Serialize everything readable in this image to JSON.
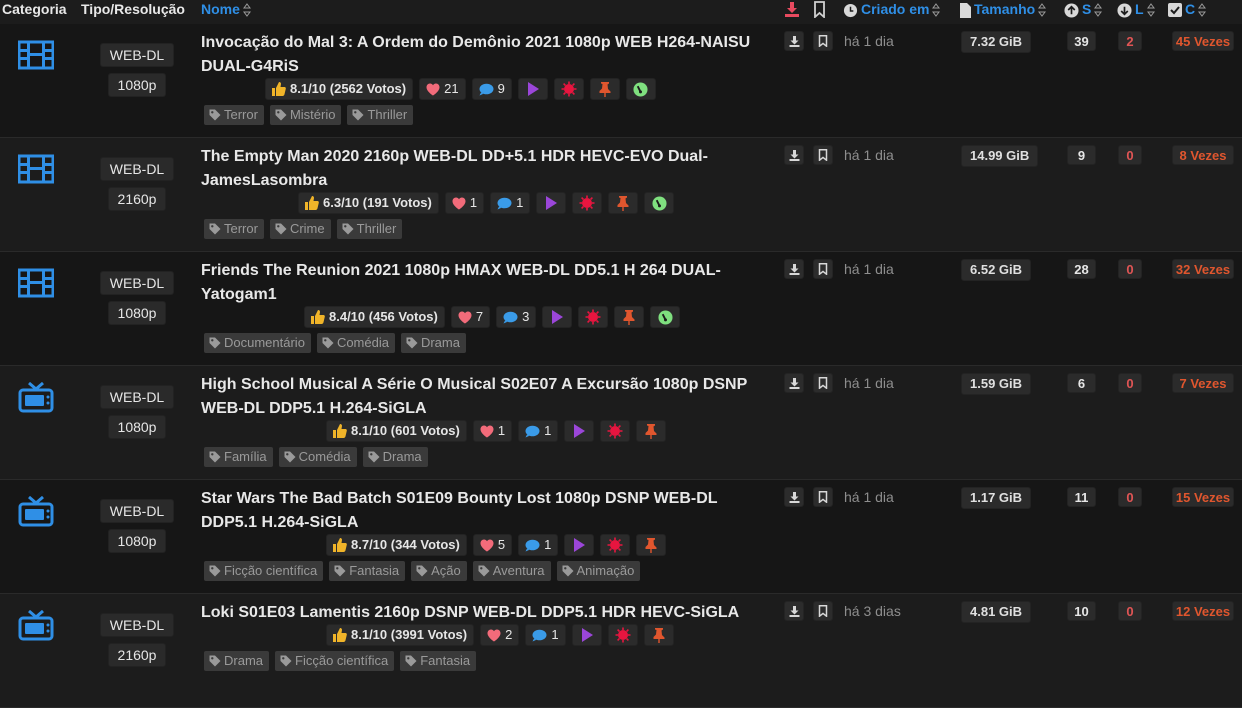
{
  "header": {
    "categoria": "Categoria",
    "tipo": "Tipo/Resolução",
    "nome": "Nome",
    "criado": "Criado em",
    "tamanho": "Tamanho",
    "s": "S",
    "l": "L",
    "c": "C"
  },
  "colors": {
    "accent": "#2f8fe6",
    "download": "#e84a5f",
    "leech": "#e05555",
    "completed": "#e0562e",
    "like": "#f26b7a",
    "rating": "#f0b429"
  },
  "rows": [
    {
      "category_icon": "film-icon",
      "type": "WEB-DL",
      "resolution": "1080p",
      "title": "Invocação do Mal 3: A Ordem do Demônio 2021 1080p WEB H264-NAISU DUAL-G4RiS",
      "rating": "8.1/10 (2562 Votos)",
      "likes": "21",
      "comments": "9",
      "has_extra": true,
      "tags": [
        "Terror",
        "Mistério",
        "Thriller"
      ],
      "age": "há 1 dia",
      "size": "7.32 GiB",
      "seeders": "39",
      "leechers": "2",
      "completed": "45 Vezes"
    },
    {
      "category_icon": "film-icon",
      "type": "WEB-DL",
      "resolution": "2160p",
      "title": "The Empty Man 2020 2160p WEB-DL DD+5.1 HDR HEVC-EVO Dual-JamesLasombra",
      "rating": "6.3/10 (191 Votos)",
      "likes": "1",
      "comments": "1",
      "has_extra": true,
      "tags": [
        "Terror",
        "Crime",
        "Thriller"
      ],
      "age": "há 1 dia",
      "size": "14.99 GiB",
      "seeders": "9",
      "leechers": "0",
      "completed": "8 Vezes"
    },
    {
      "category_icon": "film-icon",
      "type": "WEB-DL",
      "resolution": "1080p",
      "title": "Friends The Reunion 2021 1080p HMAX WEB-DL DD5.1 H 264 DUAL-Yatogam1",
      "rating": "8.4/10 (456 Votos)",
      "likes": "7",
      "comments": "3",
      "has_extra": true,
      "tags": [
        "Documentário",
        "Comédia",
        "Drama"
      ],
      "age": "há 1 dia",
      "size": "6.52 GiB",
      "seeders": "28",
      "leechers": "0",
      "completed": "32 Vezes"
    },
    {
      "category_icon": "tv-icon",
      "type": "WEB-DL",
      "resolution": "1080p",
      "title": "High School Musical A Série O Musical S02E07 A Excursão 1080p DSNP WEB-DL DDP5.1 H.264-SiGLA",
      "rating": "8.1/10 (601 Votos)",
      "likes": "1",
      "comments": "1",
      "has_extra": false,
      "tags": [
        "Família",
        "Comédia",
        "Drama"
      ],
      "age": "há 1 dia",
      "size": "1.59 GiB",
      "seeders": "6",
      "leechers": "0",
      "completed": "7 Vezes"
    },
    {
      "category_icon": "tv-icon",
      "type": "WEB-DL",
      "resolution": "1080p",
      "title": "Star Wars The Bad Batch S01E09 Bounty Lost 1080p DSNP WEB-DL DDP5.1 H.264-SiGLA",
      "rating": "8.7/10 (344 Votos)",
      "likes": "5",
      "comments": "1",
      "has_extra": false,
      "tags": [
        "Ficção científica",
        "Fantasia",
        "Ação",
        "Aventura",
        "Animação"
      ],
      "age": "há 1 dia",
      "size": "1.17 GiB",
      "seeders": "11",
      "leechers": "0",
      "completed": "15 Vezes"
    },
    {
      "category_icon": "tv-icon",
      "type": "WEB-DL",
      "resolution": "2160p",
      "title": "Loki S01E03 Lamentis 2160p DSNP WEB-DL DDP5.1 HDR HEVC-SiGLA",
      "rating": "8.1/10 (3991 Votos)",
      "likes": "2",
      "comments": "1",
      "has_extra": false,
      "tags": [
        "Drama",
        "Ficção científica",
        "Fantasia"
      ],
      "age": "há 3 dias",
      "size": "4.81 GiB",
      "seeders": "10",
      "leechers": "0",
      "completed": "12 Vezes"
    }
  ]
}
